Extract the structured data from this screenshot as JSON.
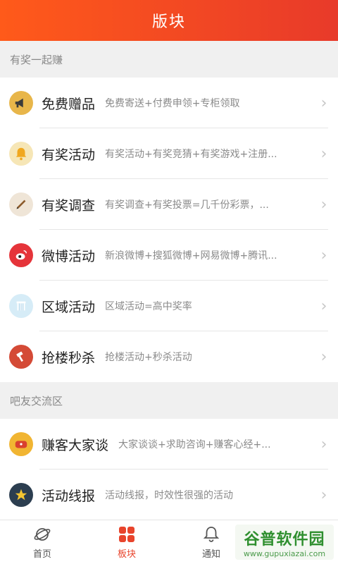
{
  "header": {
    "title": "版块"
  },
  "section1": {
    "title": "有奖一起赚",
    "items": [
      {
        "icon": "megaphone-icon",
        "title": "免费赠品",
        "subtitle": "免费寄送+付费申领+专柜领取",
        "bg": "#e8b64a"
      },
      {
        "icon": "bell-icon",
        "title": "有奖活动",
        "subtitle": "有奖活动+有奖竞猜+有奖游戏+注册...",
        "bg": "#f6e6b6"
      },
      {
        "icon": "pen-icon",
        "title": "有奖调查",
        "subtitle": "有奖调查+有奖投票=几千份彩票，...",
        "bg": "#efe5d7"
      },
      {
        "icon": "weibo-icon",
        "title": "微博活动",
        "subtitle": "新浪微博+搜狐微博+网易微博+腾讯...",
        "bg": "#e5343a"
      },
      {
        "icon": "pillar-icon",
        "title": "区域活动",
        "subtitle": "区域活动=高中奖率",
        "bg": "#d6ecf7"
      },
      {
        "icon": "hammer-icon",
        "title": "抢楼秒杀",
        "subtitle": "抢楼活动+秒杀活动",
        "bg": "#d44a36"
      }
    ]
  },
  "section2": {
    "title": "吧友交流区",
    "items": [
      {
        "icon": "chat-icon",
        "title": "赚客大家谈",
        "subtitle": "大家谈谈+求助咨询+赚客心经+...",
        "bg": "#f1b532"
      },
      {
        "icon": "star-icon",
        "title": "活动线报",
        "subtitle": "活动线报，时效性很强的活动",
        "bg": "#2c3e50"
      }
    ]
  },
  "tabs": [
    {
      "label": "首页",
      "icon": "planet-icon"
    },
    {
      "label": "板块",
      "icon": "grid-icon"
    },
    {
      "label": "通知",
      "icon": "bell-outline-icon"
    }
  ],
  "watermark": {
    "line1": "谷普软件园",
    "line2": "www.gupuxiazai.com"
  },
  "colors": {
    "accent": "#e8442c",
    "header_start": "#ff5a1a",
    "header_end": "#e83a2a"
  }
}
